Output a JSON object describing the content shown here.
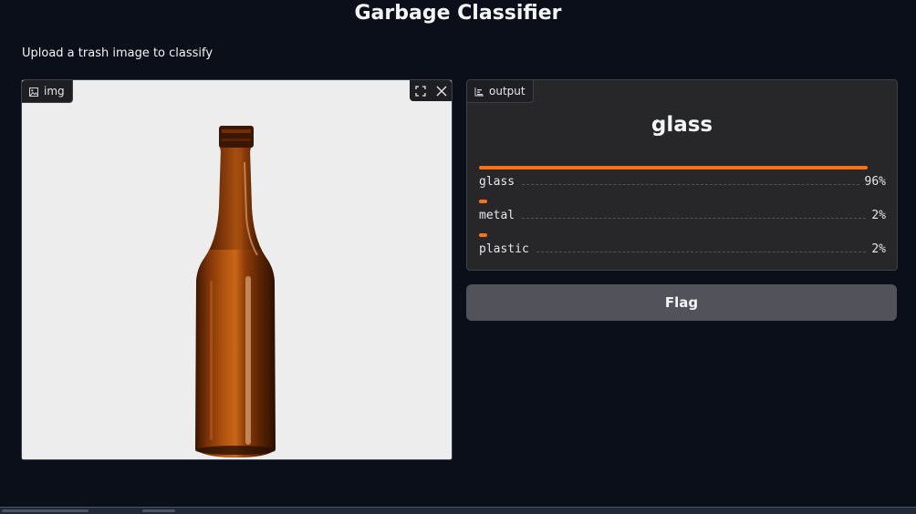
{
  "app": {
    "title": "Garbage Classifier",
    "description": "Upload a trash image to classify"
  },
  "input": {
    "label": "img",
    "icon": "image-icon",
    "controls": [
      "fullscreen-icon",
      "close-icon"
    ]
  },
  "output": {
    "label": "output",
    "icon": "bar-chart-icon",
    "prediction": "glass",
    "confidences": [
      {
        "label": "glass",
        "percent": "96%",
        "value": 0.96
      },
      {
        "label": "metal",
        "percent": "2%",
        "value": 0.02
      },
      {
        "label": "plastic",
        "percent": "2%",
        "value": 0.02
      }
    ]
  },
  "actions": {
    "flag_label": "Flag"
  },
  "colors": {
    "accent": "#f97316",
    "background": "#0b0f19",
    "panel": "#27272a",
    "button": "#52525b"
  }
}
